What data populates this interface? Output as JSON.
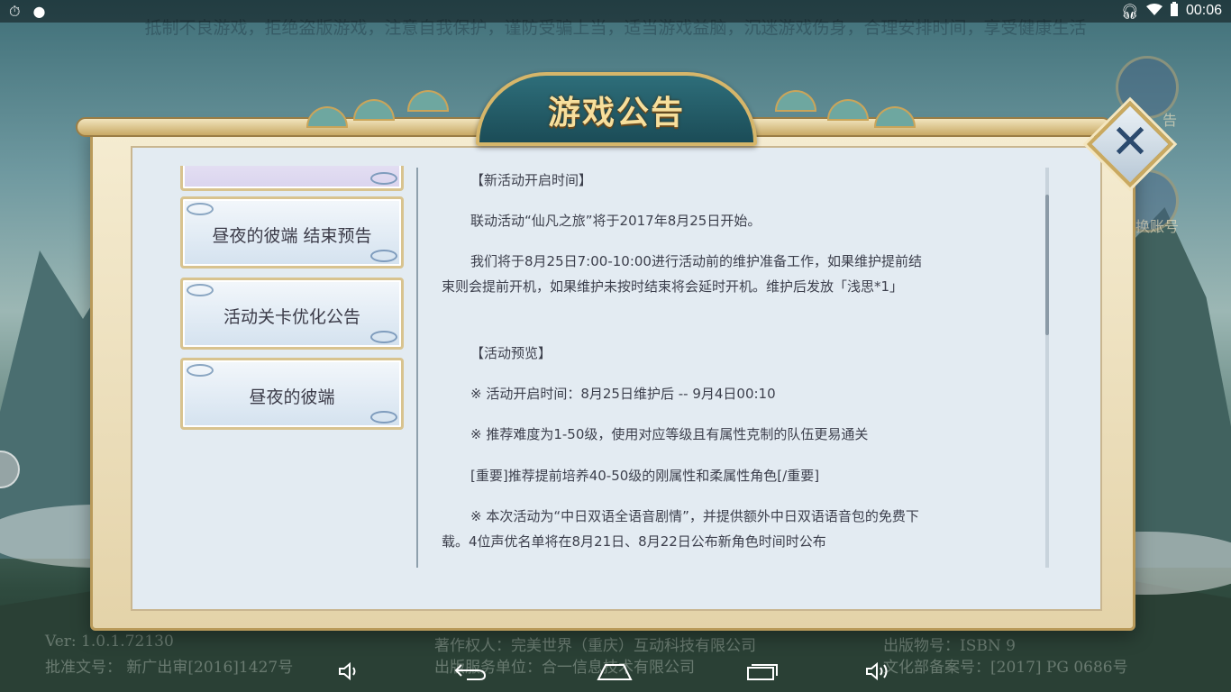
{
  "status_bar": {
    "time": "00:06",
    "icons": [
      "stopwatch-icon",
      "chat-icon",
      "headphones-icon",
      "wifi-icon",
      "battery-icon"
    ]
  },
  "warning_text": "抵制不良游戏，拒绝盗版游戏，注意自我保护，谨防受骗上当，适当游戏益脑，沉迷游戏伤身，合理安排时间，享受健康生活",
  "bottom_info": {
    "version": "Ver: 1.0.1.72130",
    "approval": "批准文号：  新广出审[2016]1427号",
    "copyright": "著作权人：完美世界（重庆）互动科技有限公司",
    "publisher": "出版服务单位：合一信息技术有限公司",
    "isbn": "出版物号：ISBN 9",
    "culture": "文化部备案号：[2017]      PG 0686号"
  },
  "side_buttons": {
    "top_label": "告",
    "bottom_label": "换账号"
  },
  "dialog": {
    "title": "游戏公告",
    "close_icon": "close-icon",
    "tabs": [
      {
        "label": ""
      },
      {
        "label": "昼夜的彼端 结束预告"
      },
      {
        "label": "活动关卡优化公告"
      },
      {
        "label": "昼夜的彼端"
      }
    ],
    "content": [
      "【新活动开启时间】",
      "联动活动“仙凡之旅”将于2017年8月25日开始。",
      "我们将于8月25日7:00-10:00进行活动前的维护准备工作，如果维护提前结束则会提前开机，如果维护未按时结束将会延时开机。维护后发放「浅思*1」",
      "【活动预览】",
      "※ 活动开启时间：8月25日维护后 -- 9月4日00:10",
      "※ 推荐难度为1-50级，使用对应等级且有属性克制的队伍更易通关",
      "[重要]推荐提前培养40-50级的刚属性和柔属性角色[/重要]",
      "※ 本次活动为“中日双语全语音剧情”，并提供额外中日双语语音包的免费下载。4位声优名单将在8月21日、8月22日公布新角色时间时公布"
    ]
  },
  "nav_bar": {
    "buttons": [
      "volume-down-icon",
      "back-icon",
      "home-icon",
      "recent-apps-icon",
      "volume-up-icon"
    ]
  }
}
